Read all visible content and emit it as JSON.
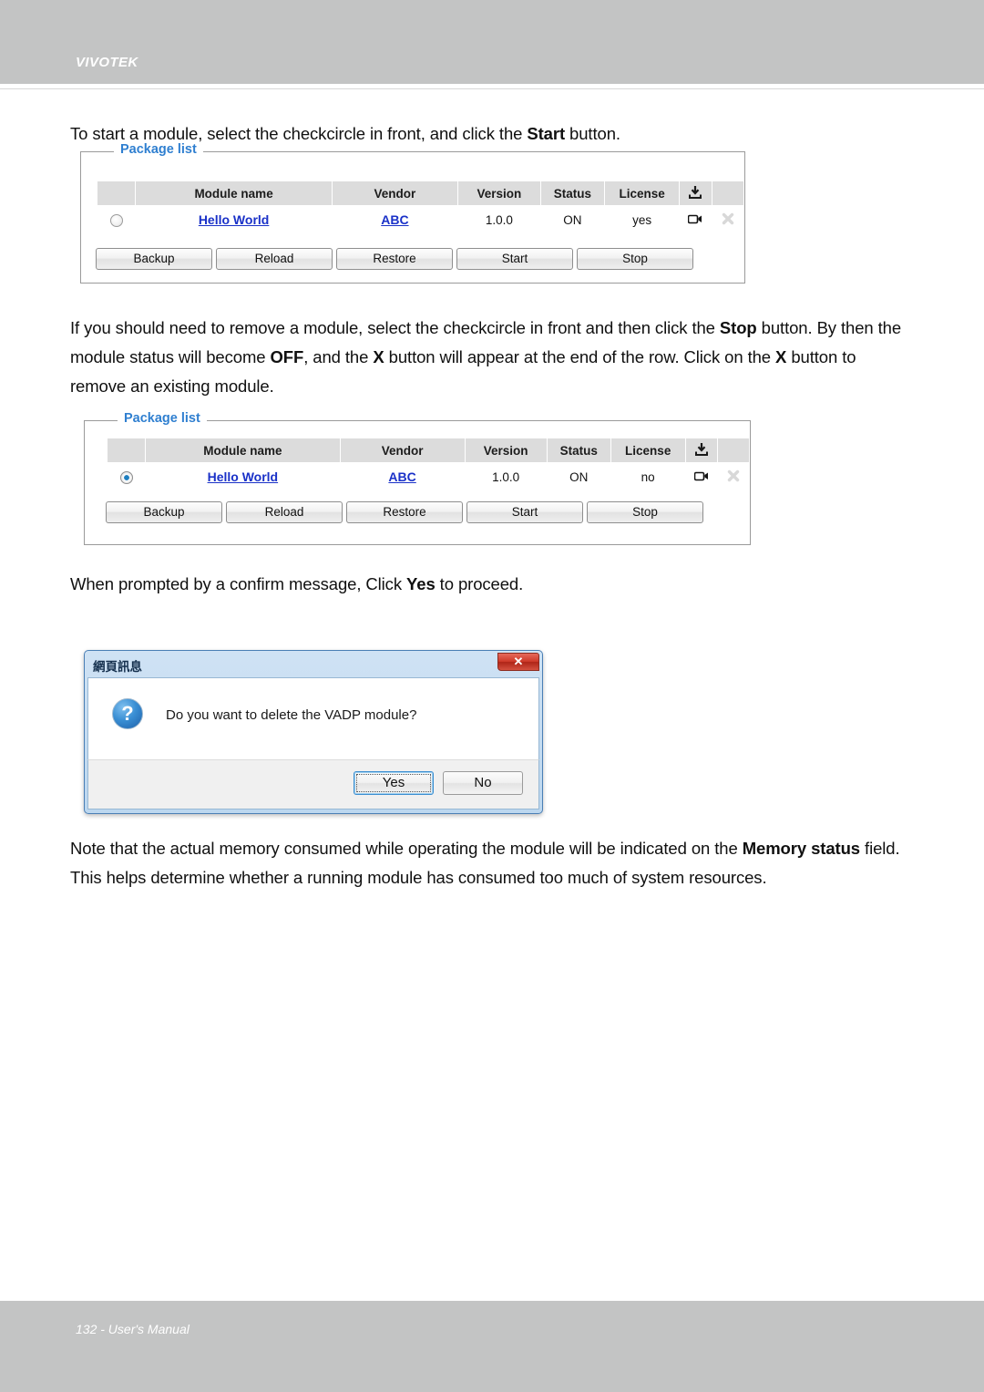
{
  "header": {
    "brand": "VIVOTEK"
  },
  "footer": {
    "text": "132 - User's Manual"
  },
  "paragraphs": {
    "p1_a": "To start a module, select the checkcircle in front, and click the ",
    "p1_b": "Start",
    "p1_c": " button.",
    "p2_a": "If you should need to remove a module, select the checkcircle in front and then click the ",
    "p2_b": "Stop",
    "p2_c": " button. By then the module status will become ",
    "p2_d": "OFF",
    "p2_e": ", and the ",
    "p2_f": "X",
    "p2_g": " button will appear at the end of the row. Click on the ",
    "p2_h": "X",
    "p2_i": " button to remove an existing module.",
    "p3_a": "When prompted by a confirm message, Click ",
    "p3_b": "Yes",
    "p3_c": " to proceed.",
    "p4_a": "Note that the actual memory consumed while operating the module will be indicated on the ",
    "p4_b": "Memory status",
    "p4_c": " field. This helps determine whether a running module has consumed too much of system resources."
  },
  "package_list_1": {
    "legend": "Package list",
    "columns": {
      "select": "",
      "module_name": "Module name",
      "vendor": "Vendor",
      "version": "Version",
      "status": "Status",
      "license": "License",
      "download": "download-icon",
      "remove": ""
    },
    "row": {
      "selected": false,
      "module_name": "Hello World",
      "vendor": "ABC",
      "version": "1.0.0",
      "status": "ON",
      "license": "yes"
    },
    "buttons": [
      "Backup",
      "Reload",
      "Restore",
      "Start",
      "Stop"
    ]
  },
  "package_list_2": {
    "legend": "Package list",
    "columns": {
      "select": "",
      "module_name": "Module name",
      "vendor": "Vendor",
      "version": "Version",
      "status": "Status",
      "license": "License",
      "download": "download-icon",
      "remove": ""
    },
    "row": {
      "selected": true,
      "module_name": "Hello World",
      "vendor": "ABC",
      "version": "1.0.0",
      "status": "ON",
      "license": "no"
    },
    "buttons": [
      "Backup",
      "Reload",
      "Restore",
      "Start",
      "Stop"
    ]
  },
  "dialog": {
    "title": "網頁訊息",
    "close_label": "✕",
    "message": "Do you want to delete the VADP module?",
    "yes_label": "Yes",
    "no_label": "No",
    "icon": "question-icon"
  },
  "colors": {
    "chrome_gray": "#c3c4c4",
    "legend_blue": "#2f7fd0",
    "link_blue": "#1a31c8",
    "table_header_gray": "#dcdcdc",
    "dialog_blue": "#bcd7ef",
    "close_red": "#cf3a2a"
  }
}
